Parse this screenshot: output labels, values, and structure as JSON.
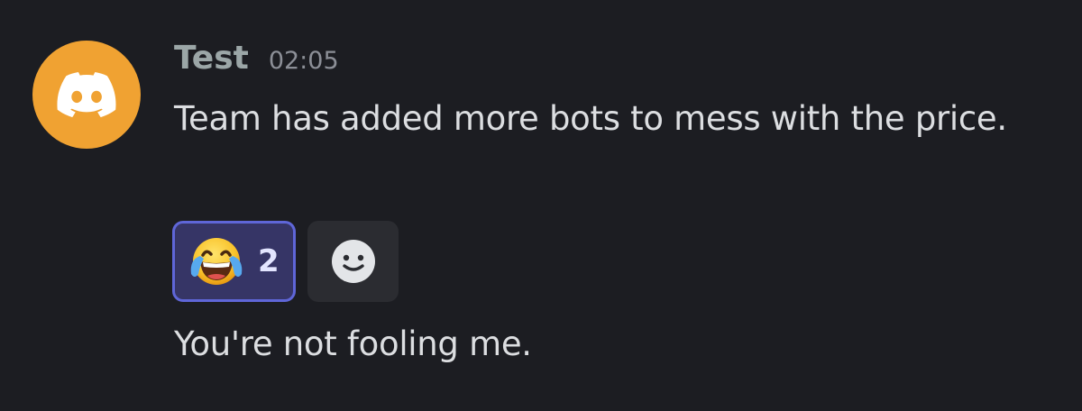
{
  "message": {
    "author": "Test",
    "timestamp": "02:05",
    "avatar_icon": "discord-logo-icon",
    "avatar_color": "#f0a232",
    "lines": [
      "Team has added more bots to mess with the price.",
      "You're not fooling me."
    ],
    "reactions": [
      {
        "emoji": "face-with-tears-of-joy",
        "count": "2",
        "active": true
      }
    ],
    "add_reaction_icon": "smiley-icon"
  },
  "colors": {
    "background": "#1c1d22",
    "username": "#9ba6a7",
    "text": "#dcdee1",
    "reaction_active_bg": "#363566",
    "reaction_active_border": "#5f66d8"
  }
}
